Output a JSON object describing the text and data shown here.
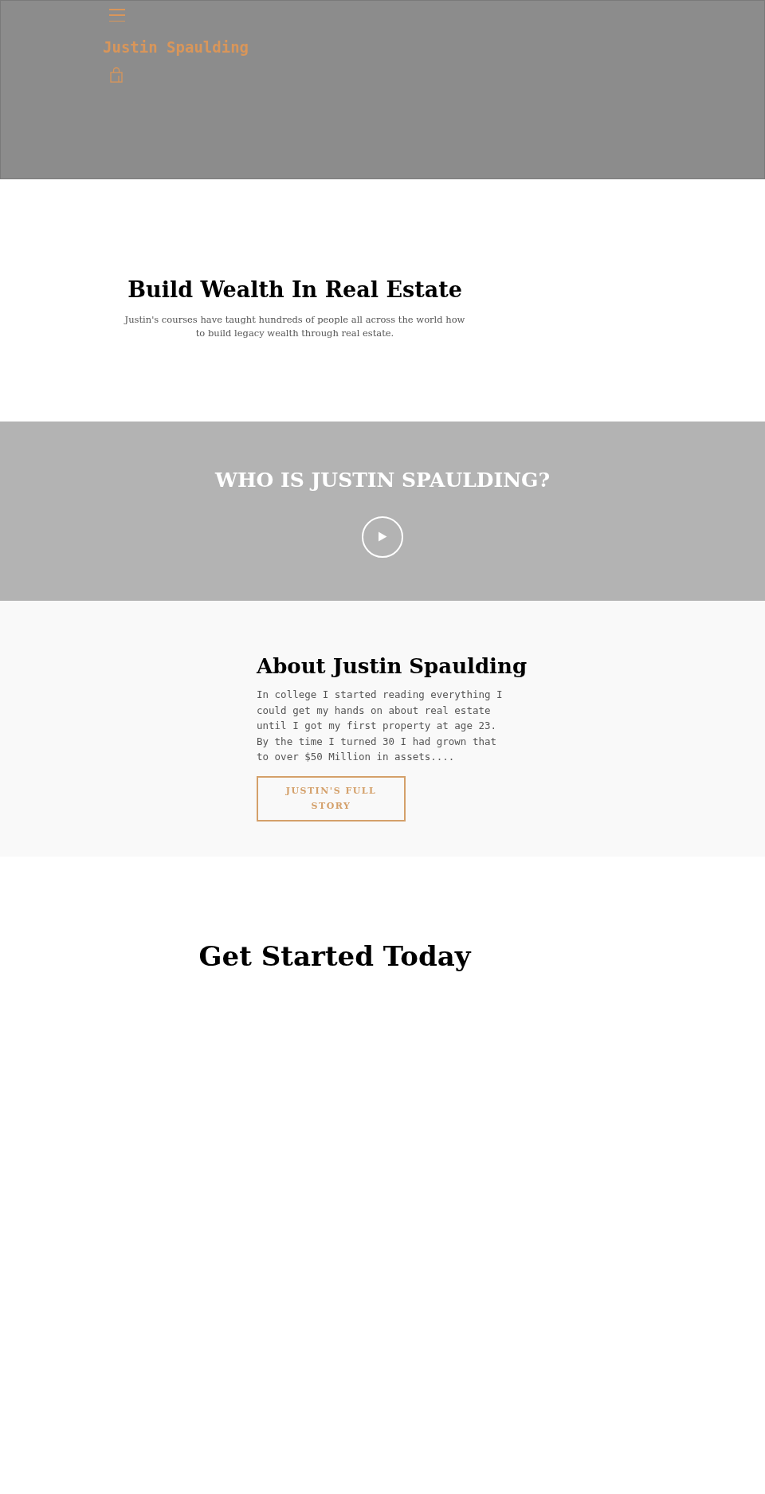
{
  "header": {
    "logo": "Justin Spaulding"
  },
  "hero": {
    "title": "Build Wealth In Real Estate",
    "text": "Justin's courses have taught hundreds of people all across the world how to build legacy wealth through real estate."
  },
  "video": {
    "title": "WHO IS JUSTIN SPAULDING?"
  },
  "about": {
    "title": "About Justin Spaulding",
    "text": "In college I started reading everything I could get my hands on about real estate until I got my first property at age 23. By the time I turned 30 I had grown that to over $50 Million in assets....",
    "button": "JUSTIN'S FULL STORY"
  },
  "cta": {
    "title": "Get Started Today"
  }
}
